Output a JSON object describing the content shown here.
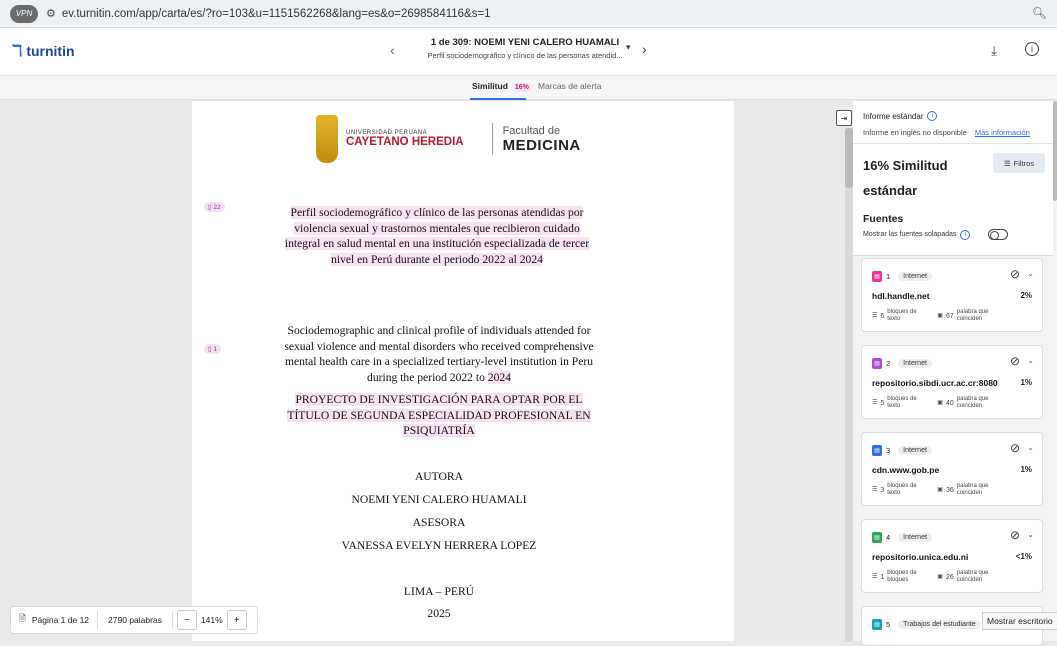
{
  "browser": {
    "vpn_label": "VPN",
    "url": "ev.turnitin.com/app/carta/es/?ro=103&u=1151562268&lang=es&o=2698584116&s=1"
  },
  "app": {
    "logo_text": "turnitin",
    "doc_counter_title": "1 de 309: NOEMI YENI CALERO HUAMALI",
    "doc_subtitle": "Perfil sociodemográfico y clínico de las personas atendid..."
  },
  "tabs": [
    {
      "label": "Similitud",
      "badge": "16%"
    },
    {
      "label": "Marcas de alerta"
    }
  ],
  "document": {
    "university_small": "UNIVERSIDAD PERUANA",
    "university_big": "CAYETANO HEREDIA",
    "faculty_small": "Facultad de",
    "faculty_big": "MEDICINA",
    "marker_1": "22",
    "marker_2": "1",
    "title_es": "Perfil sociodemográfico y clínico de las personas atendidas por violencia sexual y trastornos mentales que recibieron cuidado integral en salud mental en una institución especializada de tercer nivel en Perú durante el periodo 2022 al 2024",
    "title_en_main": "Sociodemographic and clinical profile of individuals attended for sexual violence and mental disorders who received comprehensive mental health care in a specialized tertiary-level institution in Peru during the period 2022 to ",
    "title_en_hl": "2024",
    "project": "PROYECTO DE INVESTIGACIÓN PARA OPTAR POR EL TÍTULO DE SEGUNDA ESPECIALIDAD PROFESIONAL EN PSIQUIATRÍA",
    "autora_label": "AUTORA",
    "autora_name": "NOEMI YENI CALERO HUAMALI",
    "asesora_label": "ASESORA",
    "asesora_name": "VANESSA EVELYN HERRERA LOPEZ",
    "place": "LIMA – PERÚ",
    "year": "2025"
  },
  "bottom_bar": {
    "page": "Página 1 de 12",
    "words": "2790 palabras",
    "zoom": "141%"
  },
  "panel": {
    "report_title": "Informe estándar",
    "english_unavailable": "Informe en inglés no disponible",
    "more_info": "Más información",
    "similarity_title": "16% Similitud estándar",
    "filters": "Filtros",
    "sources_title": "Fuentes",
    "overlap_label": "Mostrar las fuentes solapadas",
    "sources": [
      {
        "num": "1",
        "type": "Internet",
        "name": "hdl.handle.net",
        "pct": "2%",
        "blocks": "6",
        "blocks_label": "bloques de texto",
        "words": "67",
        "words_label": "palabra que coinciden",
        "color": "#e0389b"
      },
      {
        "num": "2",
        "type": "Internet",
        "name": "repositorio.sibdi.ucr.ac.cr:8080",
        "pct": "1%",
        "blocks": "5",
        "blocks_label": "bloques de texto",
        "words": "40",
        "words_label": "palabra que coinciden",
        "color": "#a64fd6"
      },
      {
        "num": "3",
        "type": "Internet",
        "name": "cdn.www.gob.pe",
        "pct": "1%",
        "blocks": "3",
        "blocks_label": "bloques de texto",
        "words": "36",
        "words_label": "palabra que coinciden",
        "color": "#2f6fde"
      },
      {
        "num": "4",
        "type": "Internet",
        "name": "repositorio.unica.edu.ni",
        "pct": "<1%",
        "blocks": "1",
        "blocks_label": "bloques de bloques",
        "words": "26",
        "words_label": "palabra que coinciden",
        "color": "#2aa55a"
      },
      {
        "num": "5",
        "type": "Trabajos del estudiante",
        "color": "#18a0b8"
      }
    ]
  },
  "tooltip": "Mostrar escritorio"
}
